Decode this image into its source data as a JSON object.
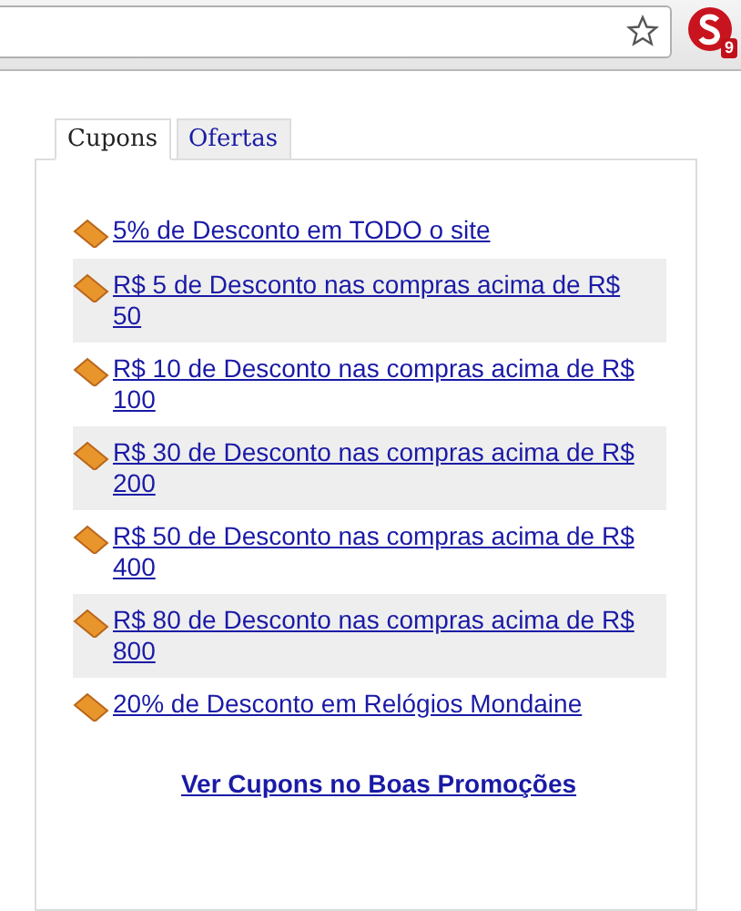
{
  "toolbar": {
    "extension_badge": "9"
  },
  "tabs": [
    {
      "label": "Cupons",
      "selected": true
    },
    {
      "label": "Ofertas",
      "selected": false
    }
  ],
  "coupons": [
    {
      "label": "5% de Desconto em TODO o site"
    },
    {
      "label": "R$ 5 de Desconto nas compras acima de R$ 50"
    },
    {
      "label": "R$ 10 de Desconto nas compras acima de R$ 100"
    },
    {
      "label": "R$ 30 de Desconto nas compras acima de R$ 200"
    },
    {
      "label": "R$ 50 de Desconto nas compras acima de R$ 400"
    },
    {
      "label": "R$ 80 de Desconto nas compras acima de R$ 800"
    },
    {
      "label": "20% de Desconto em Relógios Mondaine"
    }
  ],
  "footer_link": "Ver Cupons no Boas Promoções"
}
